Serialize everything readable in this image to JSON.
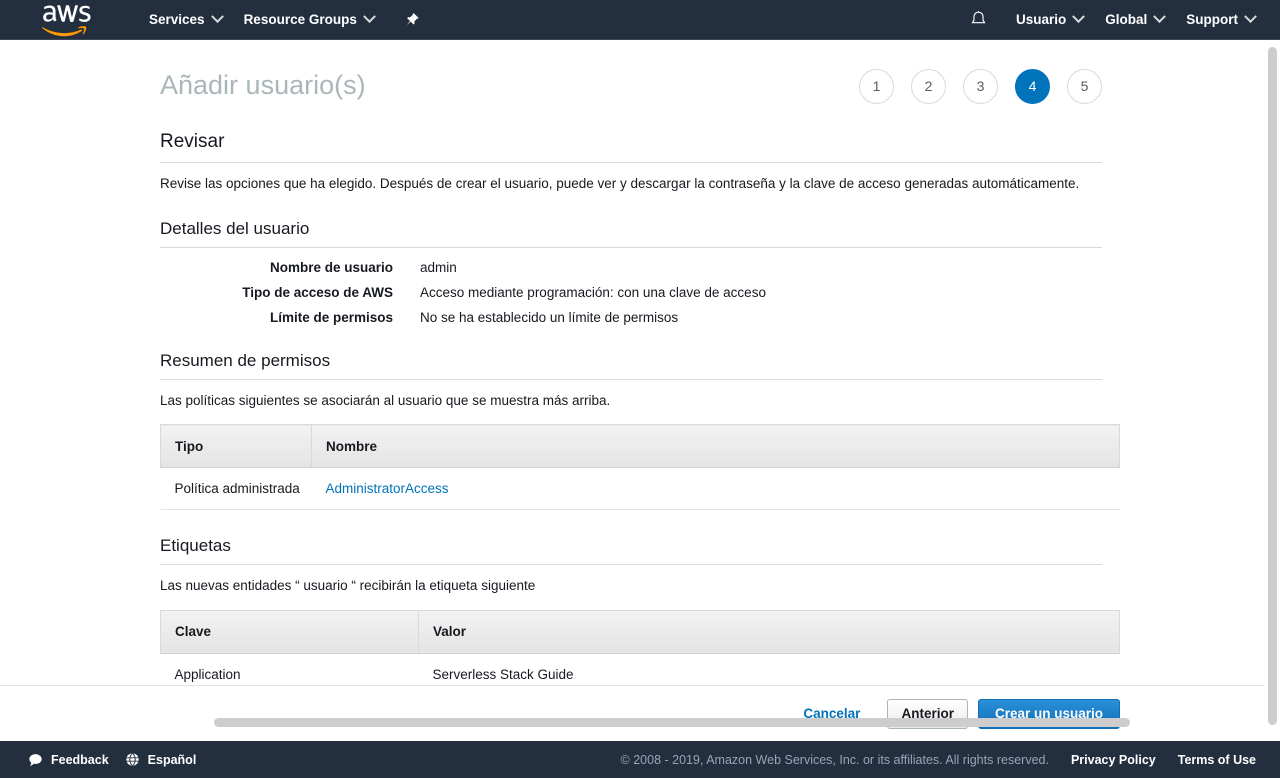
{
  "nav": {
    "logo": "aws-logo",
    "items": [
      {
        "label": "Services",
        "icon": "chevron-down-icon"
      },
      {
        "label": "Resource Groups",
        "icon": "chevron-down-icon"
      }
    ],
    "pin_icon": "pushpin-icon",
    "bell_icon": "bell-icon",
    "right_items": [
      {
        "label": "Usuario",
        "icon": "chevron-down-icon"
      },
      {
        "label": "Global",
        "icon": "chevron-down-icon"
      },
      {
        "label": "Support",
        "icon": "chevron-down-icon"
      }
    ]
  },
  "header": {
    "title": "Añadir usuario(s)",
    "steps": [
      "1",
      "2",
      "3",
      "4",
      "5"
    ],
    "active_step": "4"
  },
  "review": {
    "title": "Revisar",
    "description": "Revise las opciones que ha elegido. Después de crear el usuario, puede ver y descargar la contraseña y la clave de acceso generadas automáticamente."
  },
  "user_details": {
    "title": "Detalles del usuario",
    "rows": [
      {
        "label": "Nombre de usuario",
        "value": "admin"
      },
      {
        "label": "Tipo de acceso de AWS",
        "value": "Acceso mediante programación: con una clave de acceso"
      },
      {
        "label": "Límite de permisos",
        "value": "No se ha establecido un límite de permisos"
      }
    ]
  },
  "permissions": {
    "title": "Resumen de permisos",
    "description": "Las políticas siguientes se asociarán al usuario que se muestra más arriba.",
    "columns": [
      "Tipo",
      "Nombre"
    ],
    "rows": [
      {
        "tipo": "Política administrada",
        "nombre": "AdministratorAccess"
      }
    ]
  },
  "tags": {
    "title": "Etiquetas",
    "description": "Las nuevas entidades “ usuario “ recibirán la etiqueta siguiente",
    "columns": [
      "Clave",
      "Valor"
    ],
    "rows": [
      {
        "clave": "Application",
        "valor": "Serverless Stack Guide"
      }
    ]
  },
  "actions": {
    "cancel": "Cancelar",
    "previous": "Anterior",
    "create": "Crear un usuario"
  },
  "footer": {
    "feedback": "Feedback",
    "feedback_icon": "speech-bubble-icon",
    "language": "Español",
    "language_icon": "globe-icon",
    "copyright": "© 2008 - 2019, Amazon Web Services, Inc. or its affiliates. All rights reserved.",
    "privacy": "Privacy Policy",
    "terms": "Terms of Use"
  },
  "colors": {
    "nav_background": "#232f3e",
    "accent_blue": "#0073bb",
    "primary_button": "#0f6fb8",
    "title_gray": "#aab7b8",
    "aws_orange": "#ff9900"
  }
}
